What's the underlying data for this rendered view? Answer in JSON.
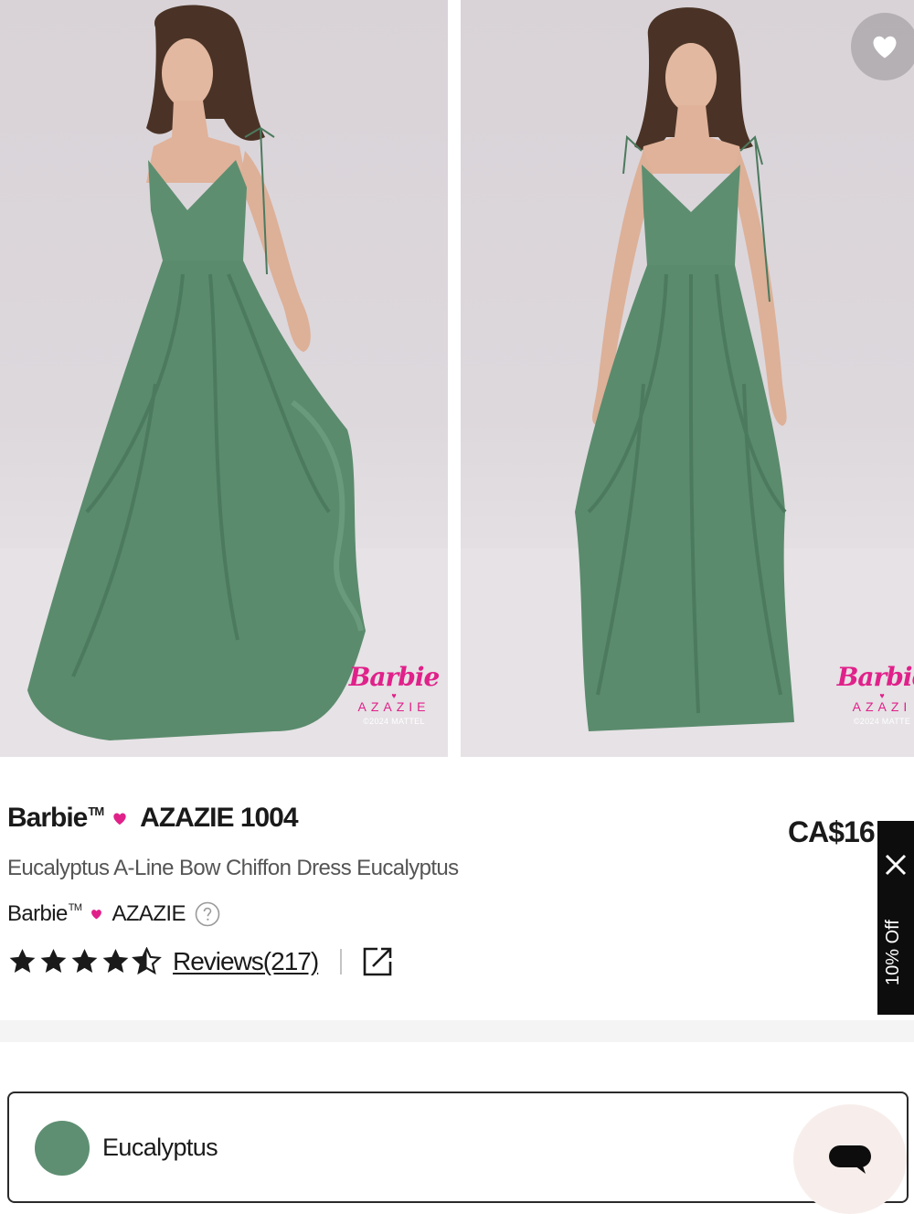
{
  "gallery": {
    "images": [
      {
        "alt": "front-view",
        "watermark": {
          "brand": "Barbie",
          "partner": "AZAZIE",
          "copyright": "©2024 MATTEL"
        }
      },
      {
        "alt": "front-view-2",
        "watermark": {
          "brand": "Barbie",
          "partner": "AZAZI",
          "copyright": "©2024 MATTE"
        }
      }
    ],
    "favorite_icon": "heart-icon"
  },
  "product": {
    "collab_left": "Barbie",
    "collab_tm": "TM",
    "collab_right": "AZAZIE 1004",
    "price": "CA$16",
    "name": "Eucalyptus A-Line Bow Chiffon Dress Eucalyptus",
    "brand_left": "Barbie",
    "brand_tm": "TM",
    "brand_right": "AZAZIE",
    "rating": 4.5,
    "reviews_label": "Reviews(217)"
  },
  "promo": {
    "text": "10% Off",
    "close_icon": "close-icon"
  },
  "color_selector": {
    "selected": "Eucalyptus",
    "swatch_color": "#5e8f72"
  },
  "colors": {
    "accent_pink": "#e0218a",
    "dress_green": "#5e8f72",
    "text_dark": "#1a1a1a"
  },
  "chat": {
    "icon": "chat-bubble-icon"
  }
}
